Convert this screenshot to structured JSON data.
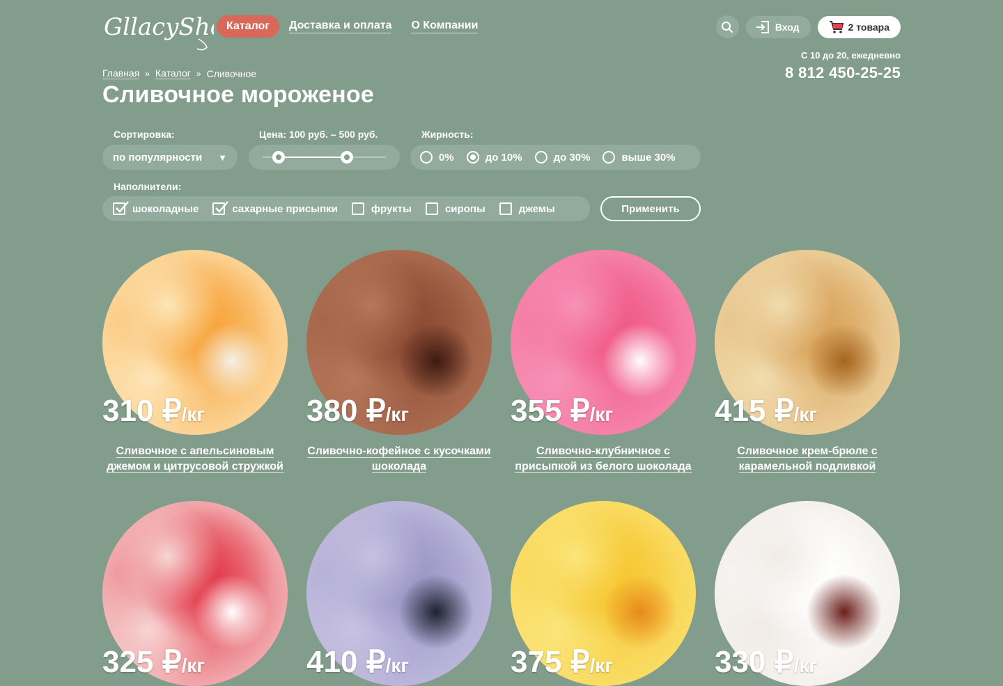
{
  "header": {
    "logo_text": "GllacyShop",
    "nav": [
      {
        "label": "Каталог"
      },
      {
        "label": "Доставка и оплата"
      },
      {
        "label": "О Компании"
      }
    ],
    "login_label": "Вход",
    "cart_label": "2 товара",
    "hours": "С 10 до 20, ежедневно",
    "phone": "8 812 450-25-25"
  },
  "breadcrumb": {
    "items": [
      "Главная",
      "Каталог",
      "Сливочное"
    ],
    "separator": "»"
  },
  "page_title": "Сливочное мороженое",
  "filters": {
    "sort_label": "Сортировка:",
    "sort_value": "по популярности",
    "price_label": "Цена: 100 руб. – 500 руб.",
    "price_range": {
      "min": 100,
      "max": 500
    },
    "fat_label": "Жирность:",
    "fat_options": [
      {
        "label": "0%",
        "checked": false
      },
      {
        "label": "до 10%",
        "checked": true
      },
      {
        "label": "до 30%",
        "checked": false
      },
      {
        "label": "выше 30%",
        "checked": false
      }
    ],
    "fillers_label": "Наполнители:",
    "fillers": [
      {
        "label": "шоколадные",
        "checked": true
      },
      {
        "label": "сахарные присыпки",
        "checked": true
      },
      {
        "label": "фрукты",
        "checked": false
      },
      {
        "label": "сиропы",
        "checked": false
      },
      {
        "label": "джемы",
        "checked": false
      }
    ],
    "apply_label": "Применить"
  },
  "products": [
    {
      "price": "310 ₽",
      "unit": "/кг",
      "title": "Сливочное с апельсиновым джемом и цитрусовой стружкой",
      "colors": [
        "#f7a43c",
        "#fde6b8",
        "#f6f0e4"
      ]
    },
    {
      "price": "380 ₽",
      "unit": "/кг",
      "title": "Сливочно-кофейное с кусочками шоколада",
      "colors": [
        "#8a4b33",
        "#b7775a",
        "#3e1a12"
      ]
    },
    {
      "price": "355 ₽",
      "unit": "/кг",
      "title": "Сливочно-клубничное с присыпкой из белого шоколада",
      "colors": [
        "#f05a8a",
        "#f792b6",
        "#ffffff"
      ]
    },
    {
      "price": "415 ₽",
      "unit": "/кг",
      "title": "Сливочное крем-брюле с карамельной подливкой",
      "colors": [
        "#d9a45c",
        "#f1dcae",
        "#a5651f"
      ]
    },
    {
      "price": "325 ₽",
      "unit": "/кг",
      "title": "",
      "colors": [
        "#e23a4a",
        "#f7d6d4",
        "#ffffff"
      ]
    },
    {
      "price": "410 ₽",
      "unit": "/кг",
      "title": "",
      "colors": [
        "#9d97c7",
        "#c7c2e2",
        "#1d2330"
      ]
    },
    {
      "price": "375 ₽",
      "unit": "/кг",
      "title": "",
      "colors": [
        "#f6c732",
        "#fbe57a",
        "#e88a1a"
      ]
    },
    {
      "price": "330 ₽",
      "unit": "/кг",
      "title": "",
      "colors": [
        "#ffffff",
        "#f0ebe6",
        "#6b1f1a"
      ]
    }
  ]
}
